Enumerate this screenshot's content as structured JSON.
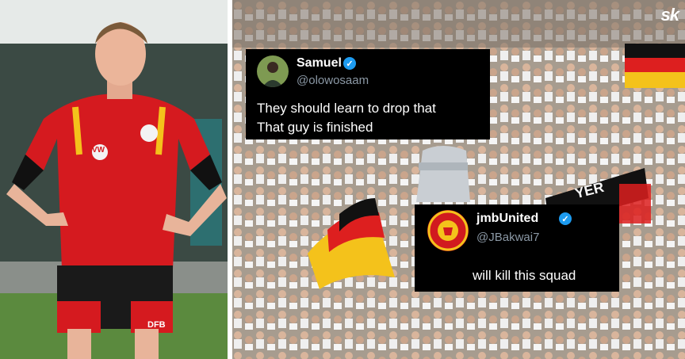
{
  "brand": {
    "logo_text": "sk"
  },
  "tweets": [
    {
      "name": "Samuel",
      "handle": "@olowosaam",
      "verified": true,
      "lines": [
        "They should learn to drop that",
        "That guy is finished"
      ]
    },
    {
      "name": "jmbUnited",
      "handle": "@JBakwai7",
      "verified": true,
      "lines": [
        "will kill this squad"
      ]
    }
  ],
  "left_photo": {
    "shirt_crest_text": "DFB",
    "sponsor_text": "VW"
  },
  "crowd_banner": {
    "text": "YER"
  },
  "colors": {
    "shirt_red": "#d51a1f",
    "flag_black": "#111111",
    "flag_red": "#dd1f1f",
    "flag_gold": "#f4c21b",
    "verified_blue": "#1d9bf0",
    "handle_grey": "#8b98a5"
  }
}
